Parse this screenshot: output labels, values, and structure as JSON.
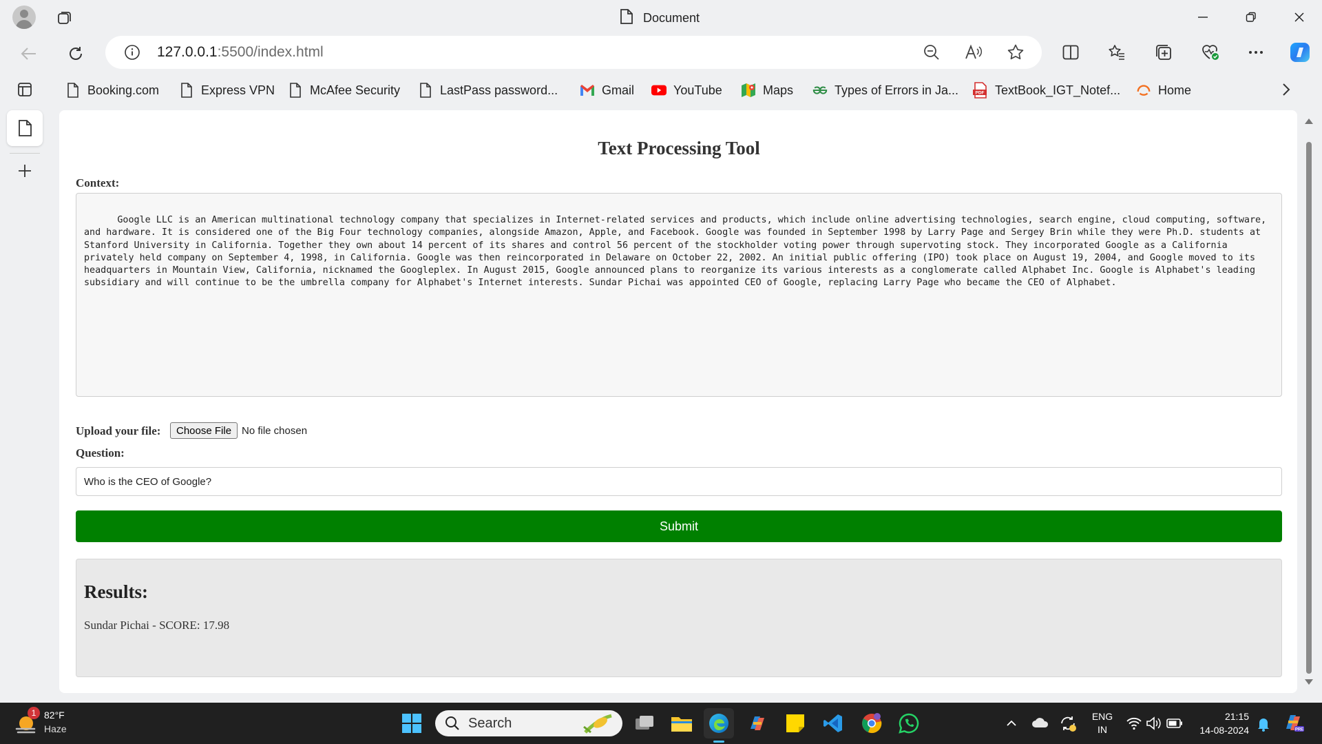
{
  "window": {
    "title": "Document"
  },
  "address_bar": {
    "url_host": "127.0.0.1",
    "url_rest": ":5500/index.html"
  },
  "favorites": [
    {
      "label": "Booking.com",
      "icon": "page-icon"
    },
    {
      "label": "Express VPN",
      "icon": "page-icon"
    },
    {
      "label": "McAfee Security",
      "icon": "page-icon"
    },
    {
      "label": "LastPass password...",
      "icon": "page-icon"
    },
    {
      "label": "Gmail",
      "icon": "gmail-icon"
    },
    {
      "label": "YouTube",
      "icon": "youtube-icon"
    },
    {
      "label": "Maps",
      "icon": "maps-icon"
    },
    {
      "label": "Types of Errors in Ja...",
      "icon": "gfg-icon"
    },
    {
      "label": "TextBook_IGT_Notef...",
      "icon": "pdf-icon"
    },
    {
      "label": "Home",
      "icon": "home-site-icon"
    }
  ],
  "page": {
    "title": "Text Processing Tool",
    "context_label": "Context:",
    "context_text": "Google LLC is an American multinational technology company that specializes in Internet-related services and products, which include online advertising technologies, search engine, cloud computing, software, and hardware. It is considered one of the Big Four technology companies, alongside Amazon, Apple, and Facebook. Google was founded in September 1998 by Larry Page and Sergey Brin while they were Ph.D. students at Stanford University in California. Together they own about 14 percent of its shares and control 56 percent of the stockholder voting power through supervoting stock. They incorporated Google as a California privately held company on September 4, 1998, in California. Google was then reincorporated in Delaware on October 22, 2002. An initial public offering (IPO) took place on August 19, 2004, and Google moved to its headquarters in Mountain View, California, nicknamed the Googleplex. In August 2015, Google announced plans to reorganize its various interests as a conglomerate called Alphabet Inc. Google is Alphabet's leading subsidiary and will continue to be the umbrella company for Alphabet's Internet interests. Sundar Pichai was appointed CEO of Google, replacing Larry Page who became the CEO of Alphabet.",
    "upload_label": "Upload your file:",
    "file_button": "Choose File",
    "file_status": "No file chosen",
    "question_label": "Question:",
    "question_value": "Who is the CEO of Google?",
    "submit_label": "Submit",
    "results_heading": "Results:",
    "results_text": "Sundar Pichai - SCORE: 17.98"
  },
  "taskbar": {
    "weather_temp": "82°F",
    "weather_desc": "Haze",
    "weather_badge": "1",
    "search_placeholder": "Search",
    "lang_top": "ENG",
    "lang_bottom": "IN",
    "time": "21:15",
    "date": "14-08-2024"
  },
  "colors": {
    "submit_green": "#008000",
    "browser_chrome": "#eff0f2",
    "taskbar": "#202020"
  }
}
